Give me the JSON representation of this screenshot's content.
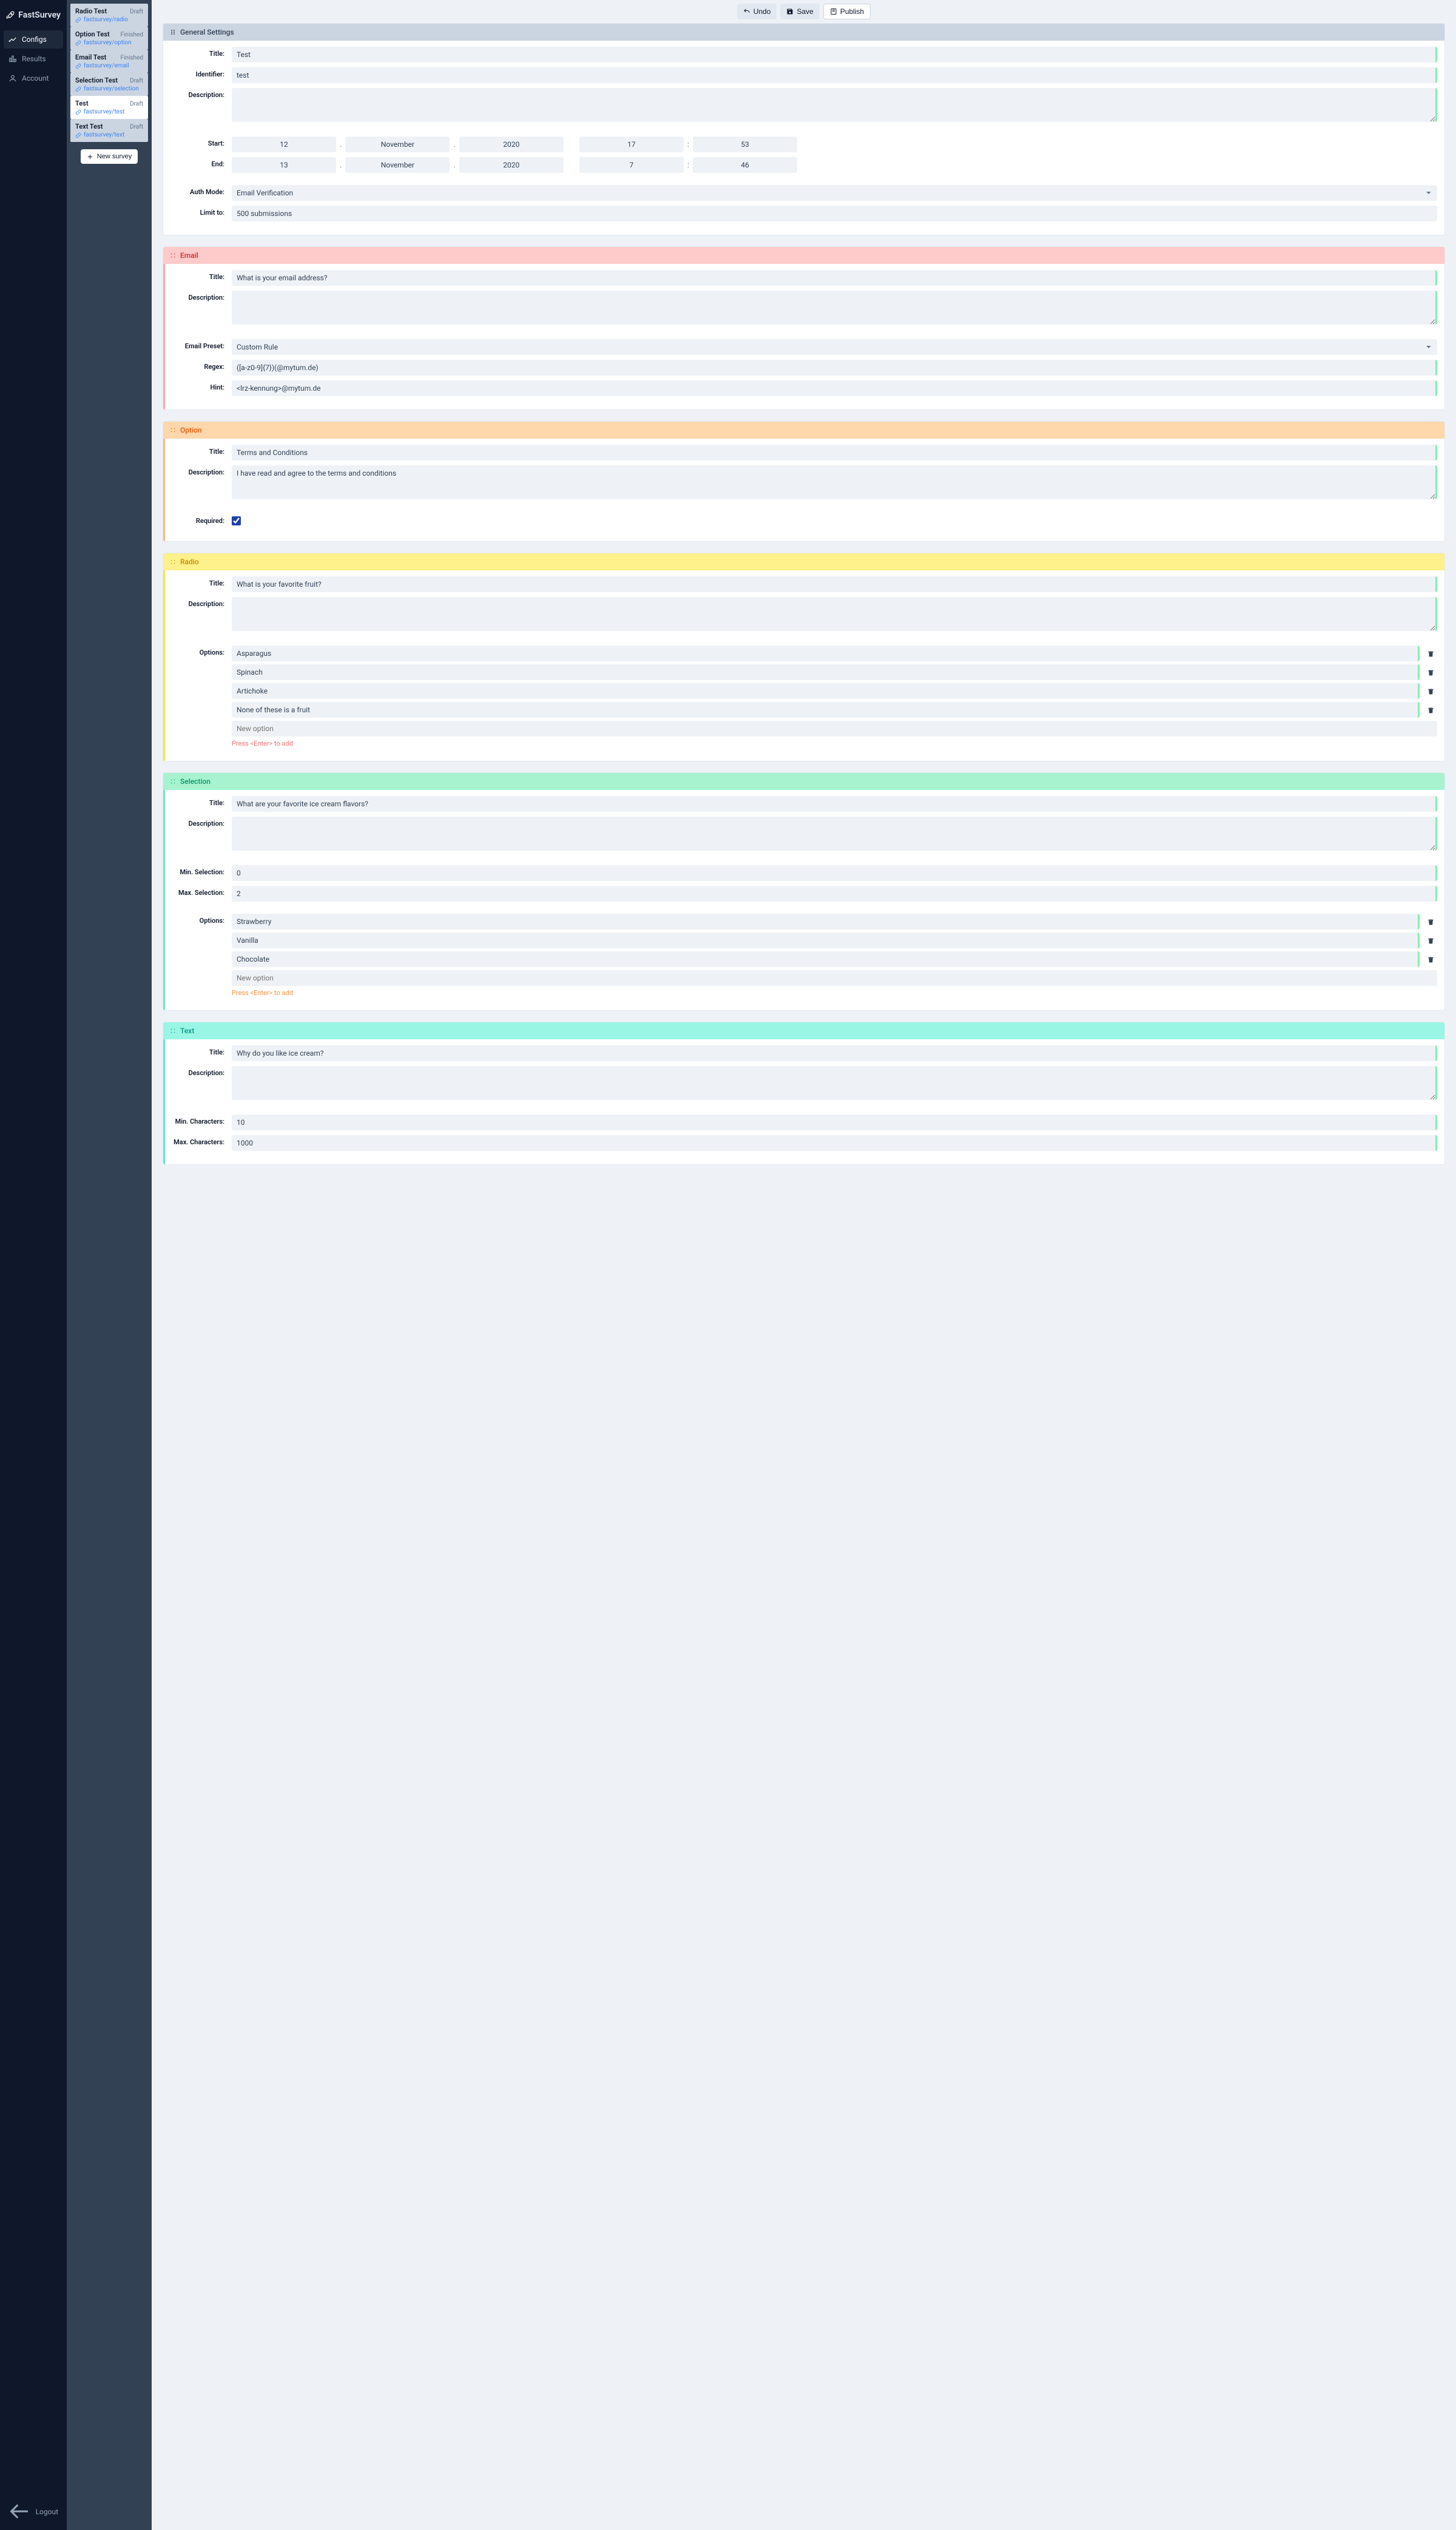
{
  "brand": "FastSurvey",
  "nav": {
    "configs": "Configs",
    "results": "Results",
    "account": "Account",
    "logout": "Logout"
  },
  "surveys": [
    {
      "title": "Radio Test",
      "status": "Draft",
      "link": "fastsurvey/radio"
    },
    {
      "title": "Option Test",
      "status": "Finished",
      "link": "fastsurvey/option"
    },
    {
      "title": "Email Test",
      "status": "Finished",
      "link": "fastsurvey/email"
    },
    {
      "title": "Selection Test",
      "status": "Draft",
      "link": "fastsurvey/selection"
    },
    {
      "title": "Test",
      "status": "Draft",
      "link": "fastsurvey/test"
    },
    {
      "title": "Text Test",
      "status": "Draft",
      "link": "fastsurvey/text"
    }
  ],
  "toolbar": {
    "new_survey": "New survey",
    "undo": "Undo",
    "save": "Save",
    "publish": "Publish"
  },
  "labels": {
    "title": "Title:",
    "identifier": "Identifier:",
    "description": "Description:",
    "start": "Start:",
    "end": "End:",
    "auth": "Auth Mode:",
    "limit": "Limit to:",
    "preset": "Email Preset:",
    "regex": "Regex:",
    "hint": "Hint:",
    "required": "Required:",
    "options": "Options:",
    "minsel": "Min. Selection:",
    "maxsel": "Max. Selection:",
    "minchar": "Min. Characters:",
    "maxchar": "Max. Characters:"
  },
  "placeholders": {
    "new_option": "New option",
    "enter_add": "Press <Enter> to add"
  },
  "general": {
    "header": "General Settings",
    "title": "Test",
    "identifier": "test",
    "description": "",
    "start": {
      "d": "12",
      "m": "November",
      "y": "2020",
      "h": "17",
      "min": "53"
    },
    "end": {
      "d": "13",
      "m": "November",
      "y": "2020",
      "h": "7",
      "min": "46"
    },
    "auth": "Email Verification",
    "limit": "500 submissions"
  },
  "email": {
    "header": "Email",
    "title": "What is your email address?",
    "description": "",
    "preset": "Custom Rule",
    "regex": "([a-z0-9]{7})(@mytum.de)",
    "hint": "<lrz-kennung>@mytum.de"
  },
  "option": {
    "header": "Option",
    "title": "Terms and Conditions",
    "description": "I have read and agree to the terms and conditions",
    "required": true
  },
  "radio": {
    "header": "Radio",
    "title": "What is your favorite fruit?",
    "description": "",
    "options": [
      "Asparagus",
      "Spinach",
      "Artichoke",
      "None of these is a fruit"
    ]
  },
  "selection": {
    "header": "Selection",
    "title": "What are your favorite ice cream flavors?",
    "description": "",
    "min": "0",
    "max": "2",
    "options": [
      "Strawberry",
      "Vanilla",
      "Chocolate"
    ]
  },
  "text": {
    "header": "Text",
    "title": "Why do you like ice cream?",
    "description": "",
    "min": "10",
    "max": "1000"
  }
}
